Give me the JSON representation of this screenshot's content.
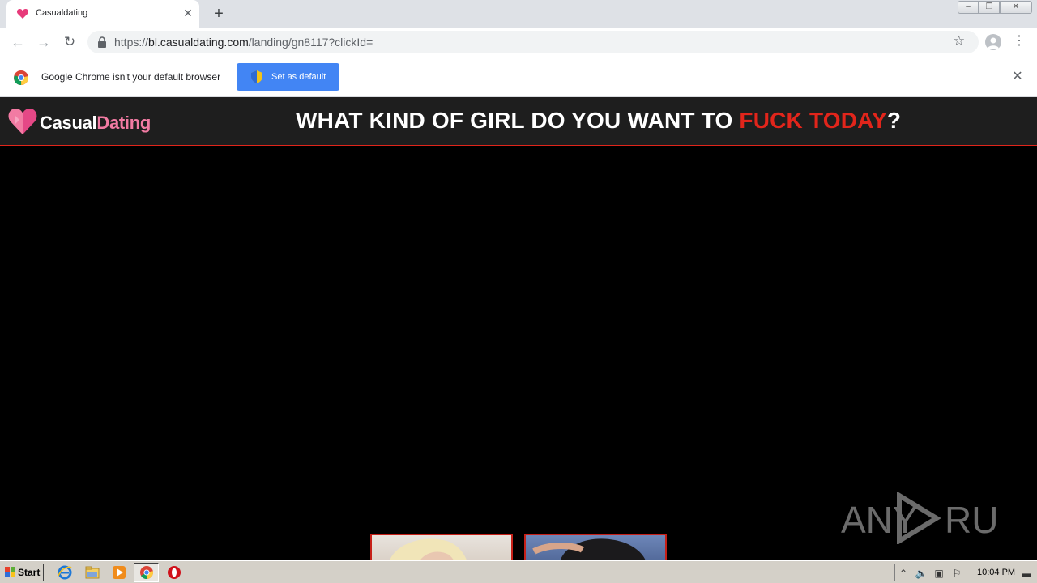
{
  "browser": {
    "tab": {
      "title": "Casualdating",
      "close_glyph": "✕"
    },
    "new_tab_glyph": "+",
    "window_controls": {
      "minimize": "‒",
      "maximize": "❐",
      "close": "✕"
    },
    "nav": {
      "back": "←",
      "forward": "→",
      "reload": "↻"
    },
    "address": {
      "scheme": "https://",
      "host": "bl.casualdating.com",
      "path": "/landing/gn8117?clickId="
    },
    "star_glyph": "☆",
    "menu_glyph": "⋮"
  },
  "infobar": {
    "message": "Google Chrome isn't your default browser",
    "button_label": "Set as default",
    "close_glyph": "✕"
  },
  "site": {
    "logo": {
      "part1": "Casual",
      "part2": "Dating"
    },
    "headline": {
      "before": "WHAT KIND OF GIRL DO YOU WANT TO ",
      "highlight": "FUCK TODAY",
      "after": "?"
    },
    "colors": {
      "accent": "#e1251b",
      "logo_pink": "#f27ba3",
      "header_bg": "#1e1e1e"
    }
  },
  "watermark": {
    "text": "ANY RUN"
  },
  "taskbar": {
    "start_label": "Start",
    "clock": "10:04 PM",
    "quicklaunch_icons": [
      "ie-icon",
      "explorer-icon",
      "media-player-icon",
      "chrome-icon",
      "opera-icon"
    ]
  }
}
